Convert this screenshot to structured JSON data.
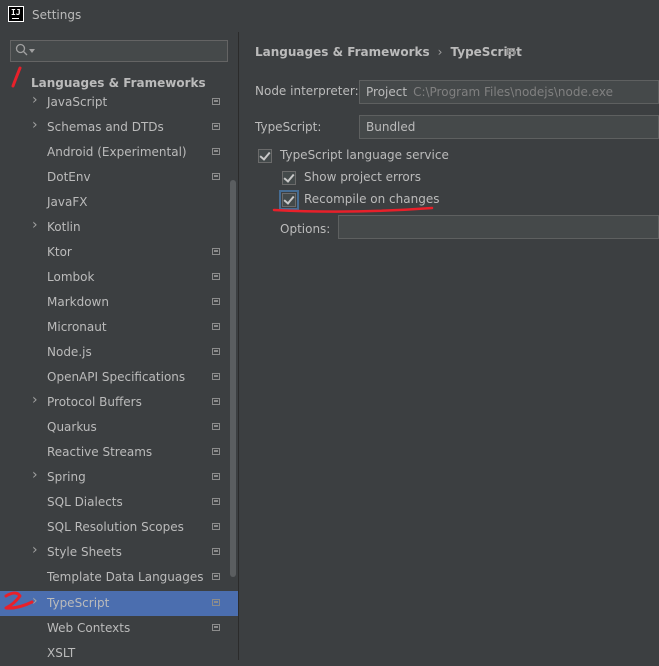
{
  "window": {
    "title": "Settings",
    "app_icon_text": "IJ"
  },
  "sidebar": {
    "search_placeholder": "",
    "root_label": "Languages & Frameworks",
    "items": [
      {
        "label": "JavaScript",
        "expandable": true,
        "project": true,
        "selected": false
      },
      {
        "label": "Schemas and DTDs",
        "expandable": true,
        "project": true,
        "selected": false
      },
      {
        "label": "Android (Experimental)",
        "expandable": false,
        "project": true,
        "selected": false
      },
      {
        "label": "DotEnv",
        "expandable": false,
        "project": true,
        "selected": false
      },
      {
        "label": "JavaFX",
        "expandable": false,
        "project": false,
        "selected": false
      },
      {
        "label": "Kotlin",
        "expandable": true,
        "project": false,
        "selected": false
      },
      {
        "label": "Ktor",
        "expandable": false,
        "project": true,
        "selected": false
      },
      {
        "label": "Lombok",
        "expandable": false,
        "project": true,
        "selected": false
      },
      {
        "label": "Markdown",
        "expandable": false,
        "project": true,
        "selected": false
      },
      {
        "label": "Micronaut",
        "expandable": false,
        "project": true,
        "selected": false
      },
      {
        "label": "Node.js",
        "expandable": false,
        "project": true,
        "selected": false
      },
      {
        "label": "OpenAPI Specifications",
        "expandable": false,
        "project": true,
        "selected": false
      },
      {
        "label": "Protocol Buffers",
        "expandable": true,
        "project": true,
        "selected": false
      },
      {
        "label": "Quarkus",
        "expandable": false,
        "project": true,
        "selected": false
      },
      {
        "label": "Reactive Streams",
        "expandable": false,
        "project": true,
        "selected": false
      },
      {
        "label": "Spring",
        "expandable": true,
        "project": true,
        "selected": false
      },
      {
        "label": "SQL Dialects",
        "expandable": false,
        "project": true,
        "selected": false
      },
      {
        "label": "SQL Resolution Scopes",
        "expandable": false,
        "project": true,
        "selected": false
      },
      {
        "label": "Style Sheets",
        "expandable": true,
        "project": true,
        "selected": false
      },
      {
        "label": "Template Data Languages",
        "expandable": false,
        "project": true,
        "selected": false
      },
      {
        "label": "TypeScript",
        "expandable": true,
        "project": true,
        "selected": true
      },
      {
        "label": "Web Contexts",
        "expandable": false,
        "project": true,
        "selected": false
      },
      {
        "label": "XSLT",
        "expandable": false,
        "project": false,
        "selected": false
      }
    ]
  },
  "main": {
    "breadcrumb": {
      "parent": "Languages & Frameworks",
      "separator": "›",
      "current": "TypeScript"
    },
    "node_interpreter": {
      "label": "Node interpreter:",
      "value": "Project",
      "path": "C:\\Program Files\\nodejs\\node.exe"
    },
    "typescript": {
      "label": "TypeScript:",
      "value": "Bundled"
    },
    "language_service": {
      "label": "TypeScript language service",
      "checked": true
    },
    "show_errors": {
      "label": "Show project errors",
      "checked": true
    },
    "recompile": {
      "label": "Recompile on changes",
      "checked": true
    },
    "options": {
      "label": "Options:",
      "value": ""
    }
  },
  "colors": {
    "background": "#3c3f41",
    "selection": "#4b6eaf",
    "annotation": "#e8202a"
  }
}
